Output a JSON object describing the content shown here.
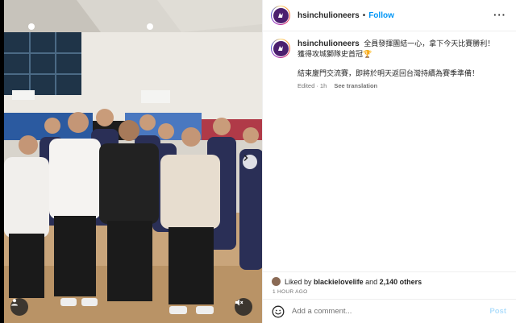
{
  "post": {
    "username": "hsinchulioneers",
    "follow_label": "Follow",
    "separator": "•",
    "more_label": "···",
    "caption": {
      "username": "hsinchulioneers",
      "line1": "全員發揮團結一心，拿下今天比賽勝利！",
      "line2": "獲得攻城獅隊史首冠🏆",
      "line3": "結束廈門交流賽，即將於明天返回台灣持續為賽季準備！"
    },
    "meta": {
      "edited": "Edited · 1h",
      "see_translation": "See translation"
    },
    "likes": {
      "prefix": "Liked by",
      "liker": "blackielovelife",
      "conjunction": "and",
      "others": "2,140 others"
    },
    "time_ago": "1 HOUR AGO",
    "comment": {
      "placeholder": "Add a comment...",
      "post_label": "Post"
    }
  },
  "colors": {
    "accent_blue": "#0095f6",
    "post_disabled": "#b2dffc",
    "team_purple": "#4b1f6f"
  },
  "icons": [
    "user-tag-icon",
    "audio-muted-icon",
    "chevron-right-icon",
    "emoji-icon",
    "more-options-icon"
  ]
}
